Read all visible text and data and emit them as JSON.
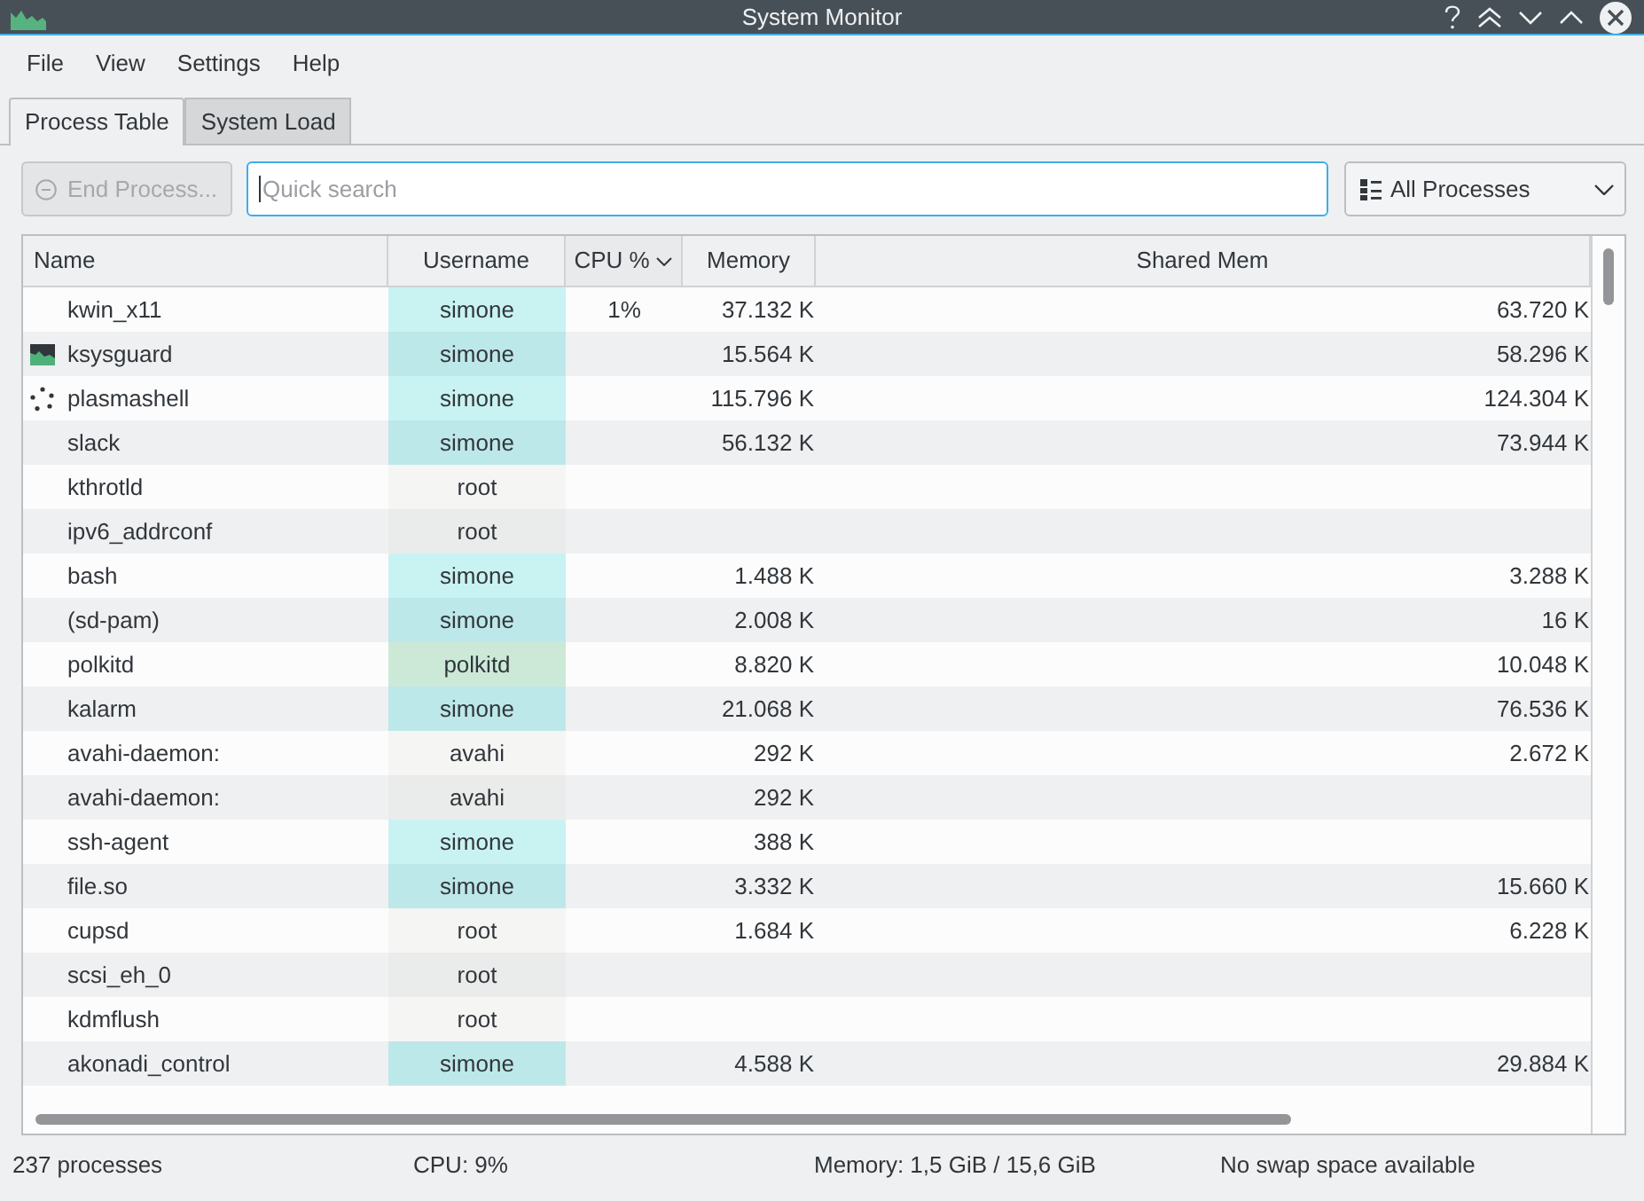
{
  "window": {
    "title": "System Monitor"
  },
  "menu": [
    "File",
    "View",
    "Settings",
    "Help"
  ],
  "tabs": [
    {
      "label": "Process Table",
      "selected": true
    },
    {
      "label": "System Load",
      "selected": false
    }
  ],
  "toolbar": {
    "end_process": {
      "label": "End Process...",
      "disabled": true
    },
    "search": {
      "placeholder": "Quick search",
      "focused": true
    },
    "filter": {
      "value": "All Processes"
    }
  },
  "table": {
    "columns": [
      {
        "label": "Name",
        "sorted": false
      },
      {
        "label": "Username",
        "sorted": false
      },
      {
        "label": "CPU %",
        "sorted": true
      },
      {
        "label": "Memory",
        "sorted": false
      },
      {
        "label": "Shared Mem",
        "sorted": false
      }
    ],
    "rows": [
      {
        "kind": "plain",
        "name": "kwin_x11",
        "username": "simone",
        "color": "#c9f3f2",
        "cpu": "1%",
        "memory": "37.132 K",
        "shared_mem": "63.720 K",
        "selected": false
      },
      {
        "kind": "chart",
        "name": "ksysguard",
        "username": "simone",
        "color": "#bde8e9",
        "memory": "15.564 K",
        "shared_mem": "58.296 K",
        "selected": false
      },
      {
        "kind": "dots",
        "name": "plasmashell",
        "username": "simone",
        "color": "#c9f3f2",
        "memory": "115.796 K",
        "shared_mem": "124.304 K",
        "selected": false
      },
      {
        "kind": "plain",
        "name": "slack",
        "username": "simone",
        "color": "#bde8e9",
        "memory": "56.132 K",
        "shared_mem": "73.944 K",
        "selected": false
      },
      {
        "kind": "plain",
        "name": "kthrotld",
        "username": "root",
        "color": "#f5f5f4",
        "selected": false
      },
      {
        "kind": "plain",
        "name": "ipv6_addrconf",
        "username": "root",
        "color": "#eaeceb",
        "selected": false
      },
      {
        "kind": "plain",
        "name": "bash",
        "username": "simone",
        "color": "#c9f3f2",
        "memory": "1.488 K",
        "shared_mem": "3.288 K",
        "selected": false
      },
      {
        "kind": "plain",
        "name": "(sd-pam)",
        "username": "simone",
        "color": "#bde8e9",
        "memory": "2.008 K",
        "shared_mem": "16 K",
        "selected": false
      },
      {
        "kind": "plain",
        "name": "polkitd",
        "username": "polkitd",
        "color": "#cce9d8",
        "memory": "8.820 K",
        "shared_mem": "10.048 K",
        "selected": false
      },
      {
        "kind": "plain",
        "name": "kalarm",
        "username": "simone",
        "color": "#bde8e9",
        "memory": "21.068 K",
        "shared_mem": "76.536 K",
        "selected": false
      },
      {
        "kind": "plain",
        "name": "avahi-daemon:",
        "username": "avahi",
        "color": "#f5f5f4",
        "memory": "292 K",
        "shared_mem": "2.672 K",
        "selected": false
      },
      {
        "kind": "plain",
        "name": "avahi-daemon:",
        "username": "avahi",
        "color": "#eaeceb",
        "memory": "292 K",
        "selected": false
      },
      {
        "kind": "plain",
        "name": "ssh-agent",
        "username": "simone",
        "color": "#c9f3f2",
        "memory": "388 K",
        "selected": false
      },
      {
        "kind": "plain",
        "name": "file.so",
        "username": "simone",
        "color": "#bde8e9",
        "memory": "3.332 K",
        "shared_mem": "15.660 K",
        "selected": false
      },
      {
        "kind": "plain",
        "name": "cupsd",
        "username": "root",
        "color": "#f5f5f4",
        "memory": "1.684 K",
        "shared_mem": "6.228 K",
        "selected": false
      },
      {
        "kind": "plain",
        "name": "scsi_eh_0",
        "username": "root",
        "color": "#eaeceb",
        "selected": false
      },
      {
        "kind": "plain",
        "name": "kdmflush",
        "username": "root",
        "color": "#f5f5f4",
        "selected": false
      },
      {
        "kind": "plain",
        "name": "akonadi_control",
        "username": "simone",
        "color": "#bde8e9",
        "memory": "4.588 K",
        "shared_mem": "29.884 K",
        "selected": false
      }
    ]
  },
  "status_bar": [
    "237 processes",
    "CPU: 9%",
    "Memory: 1,5 GiB / 15,6 GiB",
    "No swap space available"
  ]
}
